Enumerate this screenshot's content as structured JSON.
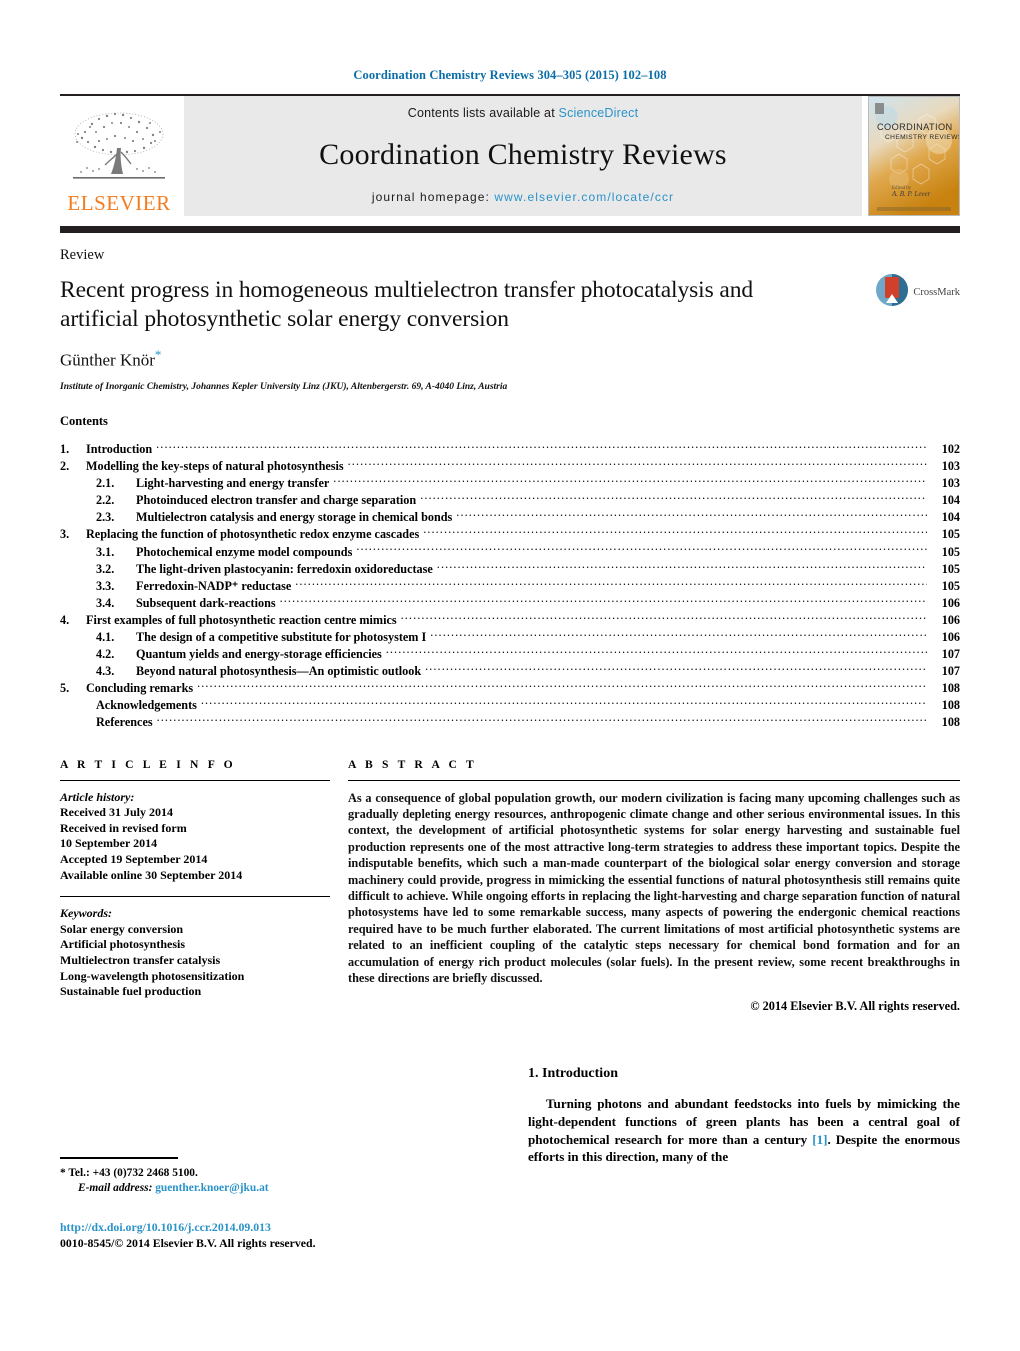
{
  "running_head": "Coordination Chemistry Reviews 304–305 (2015) 102–108",
  "masthead": {
    "contents_prefix": "Contents lists available at ",
    "sciencedirect": "ScienceDirect",
    "journal_title": "Coordination Chemistry Reviews",
    "homepage_prefix": "journal homepage: ",
    "homepage_url": "www.elsevier.com/locate/ccr",
    "publisher": "ELSEVIER",
    "cover_title_line1": "COORDINATION",
    "cover_title_line2": "CHEMISTRY REVIEWS",
    "link_color": "#2a93c9",
    "brand_color": "#f47c20"
  },
  "article": {
    "type_label": "Review",
    "title": "Recent progress in homogeneous multielectron transfer photocatalysis and artificial photosynthetic solar energy conversion",
    "author": "Günther Knör",
    "author_star": "*",
    "affiliation": "Institute of Inorganic Chemistry, Johannes Kepler University Linz (JKU), Altenbergerstr. 69, A-4040 Linz, Austria",
    "crossmark_label": "CrossMark"
  },
  "contents": {
    "heading": "Contents",
    "entries": [
      {
        "num": "1.",
        "sub": "",
        "label": "Introduction",
        "page": "102"
      },
      {
        "num": "2.",
        "sub": "",
        "label": "Modelling the key-steps of natural photosynthesis",
        "page": "103"
      },
      {
        "num": "",
        "sub": "2.1.",
        "label": "Light-harvesting and energy transfer",
        "page": "103"
      },
      {
        "num": "",
        "sub": "2.2.",
        "label": "Photoinduced electron transfer and charge separation",
        "page": "104"
      },
      {
        "num": "",
        "sub": "2.3.",
        "label": "Multielectron catalysis and energy storage in chemical bonds",
        "page": "104"
      },
      {
        "num": "3.",
        "sub": "",
        "label": "Replacing the function of photosynthetic redox enzyme cascades",
        "page": "105"
      },
      {
        "num": "",
        "sub": "3.1.",
        "label": "Photochemical enzyme model compounds",
        "page": "105"
      },
      {
        "num": "",
        "sub": "3.2.",
        "label": "The light-driven plastocyanin: ferredoxin oxidoreductase",
        "page": "105"
      },
      {
        "num": "",
        "sub": "3.3.",
        "label": "Ferredoxin-NADP⁺ reductase",
        "page": "105"
      },
      {
        "num": "",
        "sub": "3.4.",
        "label": "Subsequent dark-reactions",
        "page": "106"
      },
      {
        "num": "4.",
        "sub": "",
        "label": "First examples of full photosynthetic reaction centre mimics",
        "page": "106"
      },
      {
        "num": "",
        "sub": "4.1.",
        "label": "The design of a competitive substitute for photosystem I",
        "page": "106"
      },
      {
        "num": "",
        "sub": "4.2.",
        "label": "Quantum yields and energy-storage efficiencies",
        "page": "107"
      },
      {
        "num": "",
        "sub": "4.3.",
        "label": "Beyond natural photosynthesis—An optimistic outlook",
        "page": "107"
      },
      {
        "num": "5.",
        "sub": "",
        "label": "Concluding remarks",
        "page": "108"
      },
      {
        "num": "",
        "sub": "",
        "label": "Acknowledgements",
        "page": "108",
        "noindent": true
      },
      {
        "num": "",
        "sub": "",
        "label": "References",
        "page": "108",
        "noindent": true
      }
    ]
  },
  "article_info": {
    "heading": "A R T I C L E   I N F O",
    "history_label": "Article history:",
    "history": [
      "Received 31 July 2014",
      "Received in revised form",
      "10 September 2014",
      "Accepted 19 September 2014",
      "Available online 30 September 2014"
    ],
    "keywords_label": "Keywords:",
    "keywords": [
      "Solar energy conversion",
      "Artificial photosynthesis",
      "Multielectron transfer catalysis",
      "Long-wavelength photosensitization",
      "Sustainable fuel production"
    ]
  },
  "abstract": {
    "heading": "A B S T R A C T",
    "text": "As a consequence of global population growth, our modern civilization is facing many upcoming challenges such as gradually depleting energy resources, anthropogenic climate change and other serious environmental issues. In this context, the development of artificial photosynthetic systems for solar energy harvesting and sustainable fuel production represents one of the most attractive long-term strategies to address these important topics. Despite the indisputable benefits, which such a man-made counterpart of the biological solar energy conversion and storage machinery could provide, progress in mimicking the essential functions of natural photosynthesis still remains quite difficult to achieve. While ongoing efforts in replacing the light-harvesting and charge separation function of natural photosystems have led to some remarkable success, many aspects of powering the endergonic chemical reactions required have to be much further elaborated. The current limitations of most artificial photosynthetic systems are related to an inefficient coupling of the catalytic steps necessary for chemical bond formation and for an accumulation of energy rich product molecules (solar fuels). In the present review, some recent breakthroughs in these directions are briefly discussed.",
    "copyright": "© 2014 Elsevier B.V. All rights reserved."
  },
  "body": {
    "section_heading": "1.  Introduction",
    "paragraph_part1": "Turning photons and abundant feedstocks into fuels by mimicking the light-dependent functions of green plants has been a central goal of photochemical research for more than a century ",
    "citation": "[1]",
    "paragraph_part2": ". Despite the enormous efforts in this direction, many of the"
  },
  "footnote": {
    "marker": "*",
    "tel": "Tel.: +43 (0)732 2468 5100.",
    "email_label": "E-mail address:",
    "email": "guenther.knoer@jku.at"
  },
  "imprint": {
    "doi": "http://dx.doi.org/10.1016/j.ccr.2014.09.013",
    "issn_line": "0010-8545/© 2014 Elsevier B.V. All rights reserved."
  }
}
